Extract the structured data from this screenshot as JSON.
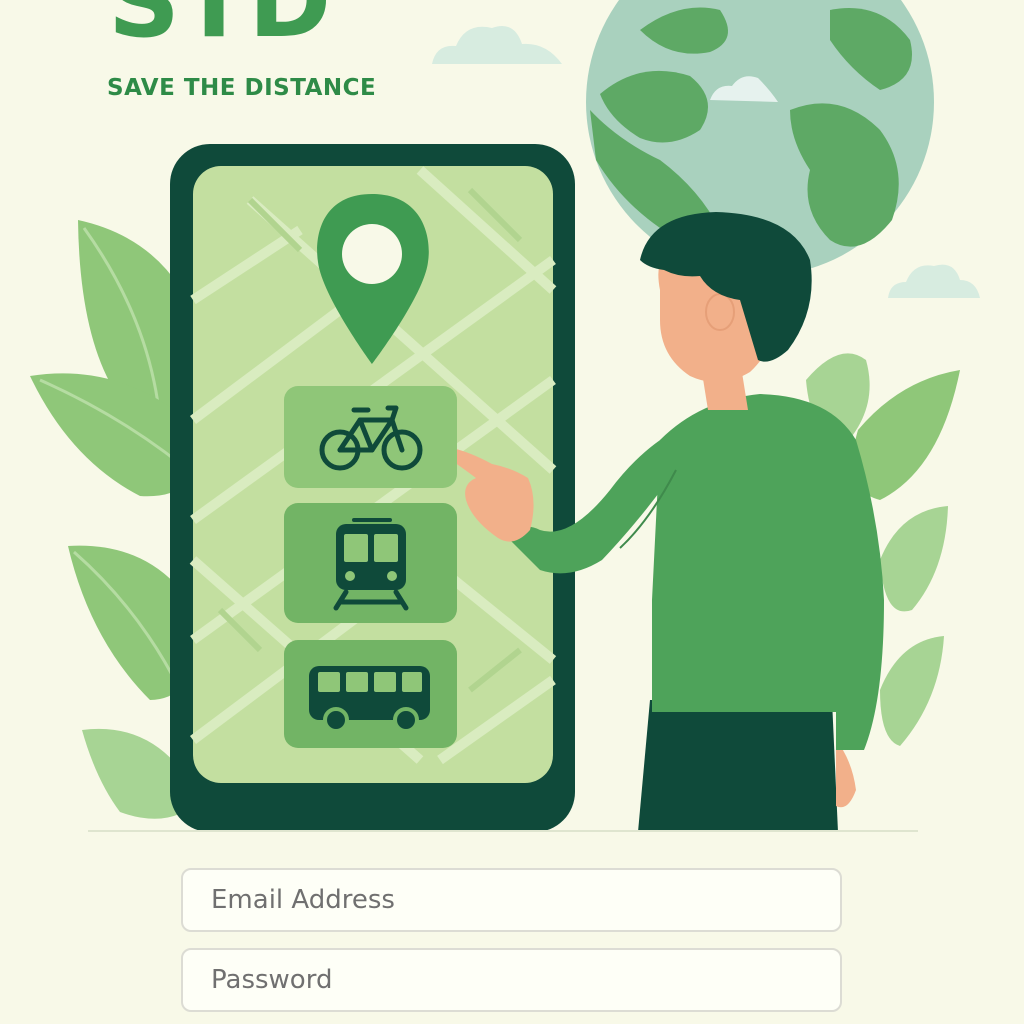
{
  "brand": {
    "logo_text": "STD",
    "tagline": "SAVE THE DISTANCE"
  },
  "transport_options": [
    {
      "icon": "bicycle-icon",
      "label": "Bike"
    },
    {
      "icon": "train-icon",
      "label": "Train"
    },
    {
      "icon": "bus-icon",
      "label": "Bus"
    }
  ],
  "login": {
    "email_placeholder": "Email Address",
    "email_value": "",
    "password_placeholder": "Password",
    "password_value": ""
  },
  "colors": {
    "background": "#f8f9e8",
    "brand_green": "#3f9b52",
    "dark_green": "#0f4a3a",
    "map_green": "#c3dfa0",
    "button_green": "#8fc678"
  }
}
